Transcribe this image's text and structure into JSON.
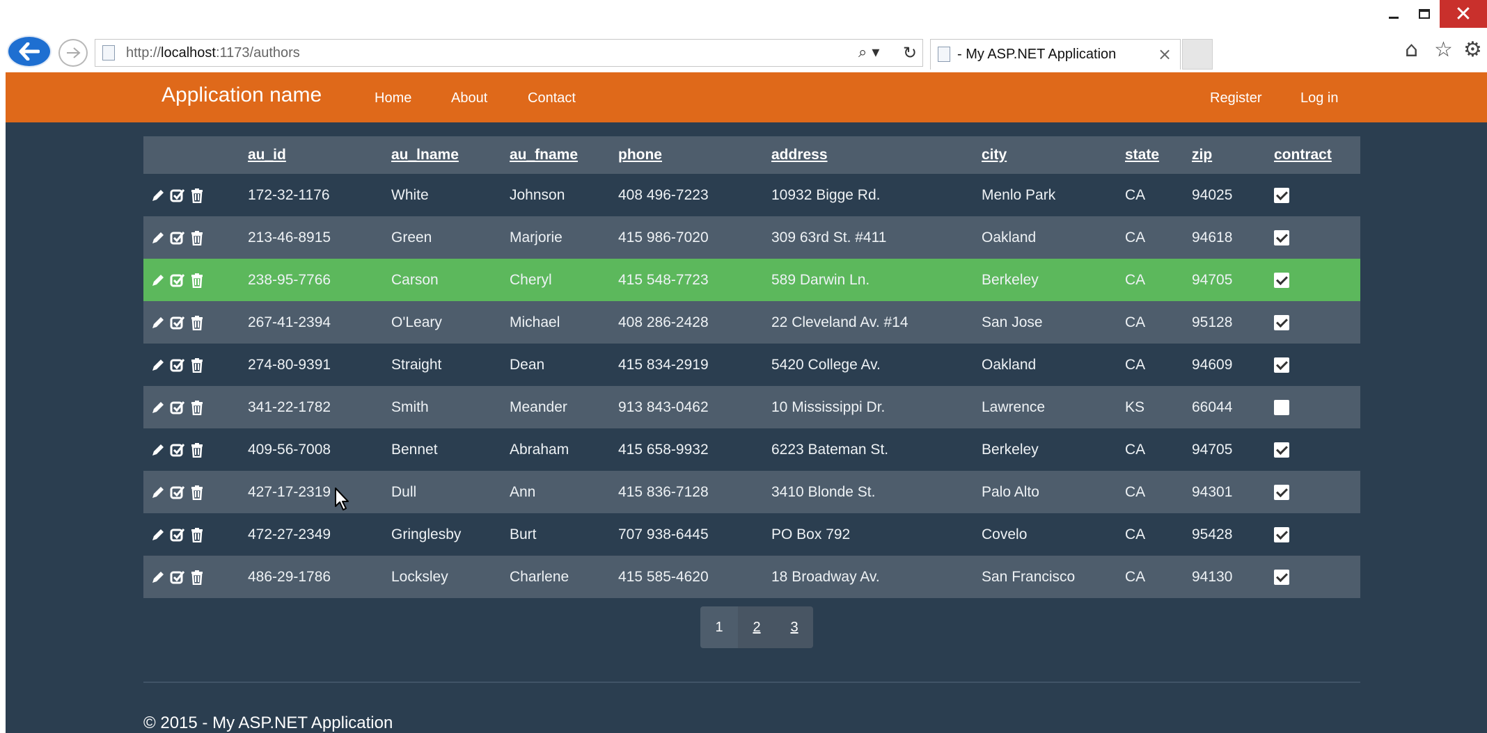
{
  "browser": {
    "url_prefix": "http://",
    "url_host": "localhost",
    "url_rest": ":1173/authors",
    "tab_title": "- My ASP.NET Application",
    "tab_close": "×",
    "window_close": "✕",
    "search_icon": "⌕ ▾",
    "refresh_icon": "↻",
    "home_icon": "⌂",
    "star_icon": "☆",
    "gear_icon": "⚙"
  },
  "navbar": {
    "brand": "Application name",
    "links": [
      "Home",
      "About",
      "Contact"
    ],
    "right_links": [
      "Register",
      "Log in"
    ]
  },
  "table": {
    "columns": [
      "au_id",
      "au_lname",
      "au_fname",
      "phone",
      "address",
      "city",
      "state",
      "zip",
      "contract"
    ],
    "rows": [
      {
        "au_id": "172-32-1176",
        "au_lname": "White",
        "au_fname": "Johnson",
        "phone": "408 496-7223",
        "address": "10932 Bigge Rd.",
        "city": "Menlo Park",
        "state": "CA",
        "zip": "94025",
        "contract": true
      },
      {
        "au_id": "213-46-8915",
        "au_lname": "Green",
        "au_fname": "Marjorie",
        "phone": "415 986-7020",
        "address": "309 63rd St. #411",
        "city": "Oakland",
        "state": "CA",
        "zip": "94618",
        "contract": true
      },
      {
        "au_id": "238-95-7766",
        "au_lname": "Carson",
        "au_fname": "Cheryl",
        "phone": "415 548-7723",
        "address": "589 Darwin Ln.",
        "city": "Berkeley",
        "state": "CA",
        "zip": "94705",
        "contract": true
      },
      {
        "au_id": "267-41-2394",
        "au_lname": "O'Leary",
        "au_fname": "Michael",
        "phone": "408 286-2428",
        "address": "22 Cleveland Av. #14",
        "city": "San Jose",
        "state": "CA",
        "zip": "95128",
        "contract": true
      },
      {
        "au_id": "274-80-9391",
        "au_lname": "Straight",
        "au_fname": "Dean",
        "phone": "415 834-2919",
        "address": "5420 College Av.",
        "city": "Oakland",
        "state": "CA",
        "zip": "94609",
        "contract": true
      },
      {
        "au_id": "341-22-1782",
        "au_lname": "Smith",
        "au_fname": "Meander",
        "phone": "913 843-0462",
        "address": "10 Mississippi Dr.",
        "city": "Lawrence",
        "state": "KS",
        "zip": "66044",
        "contract": false
      },
      {
        "au_id": "409-56-7008",
        "au_lname": "Bennet",
        "au_fname": "Abraham",
        "phone": "415 658-9932",
        "address": "6223 Bateman St.",
        "city": "Berkeley",
        "state": "CA",
        "zip": "94705",
        "contract": true
      },
      {
        "au_id": "427-17-2319",
        "au_lname": "Dull",
        "au_fname": "Ann",
        "phone": "415 836-7128",
        "address": "3410 Blonde St.",
        "city": "Palo Alto",
        "state": "CA",
        "zip": "94301",
        "contract": true
      },
      {
        "au_id": "472-27-2349",
        "au_lname": "Gringlesby",
        "au_fname": "Burt",
        "phone": "707 938-6445",
        "address": "PO Box 792",
        "city": "Covelo",
        "state": "CA",
        "zip": "95428",
        "contract": true
      },
      {
        "au_id": "486-29-1786",
        "au_lname": "Locksley",
        "au_fname": "Charlene",
        "phone": "415 585-4620",
        "address": "18 Broadway Av.",
        "city": "San Francisco",
        "state": "CA",
        "zip": "94130",
        "contract": true
      }
    ],
    "selected_row_index": 2
  },
  "pager": {
    "pages": [
      "1",
      "2",
      "3"
    ],
    "current": "1"
  },
  "footer": {
    "text": "© 2015 - My ASP.NET Application"
  },
  "colors": {
    "navbar": "#df691a",
    "page_bg": "#2b3e50",
    "row_alt": "#4e5d6c",
    "row_selected": "#5cb85c"
  }
}
